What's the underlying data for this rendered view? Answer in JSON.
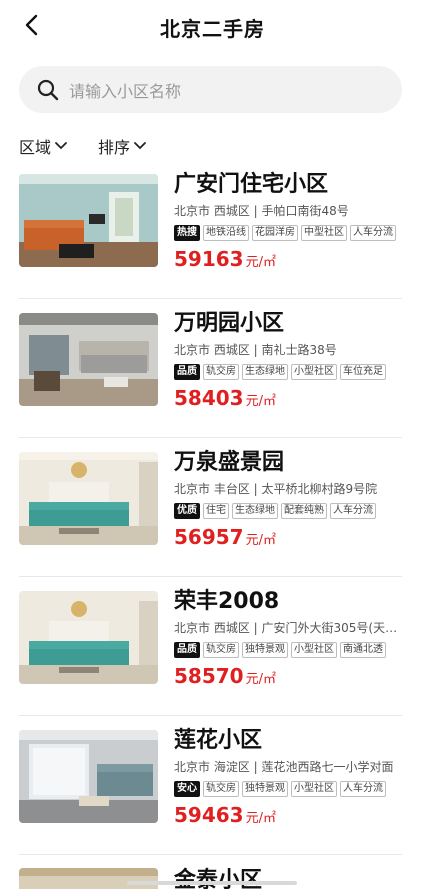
{
  "header": {
    "title": "北京二手房"
  },
  "search": {
    "placeholder": "请输入小区名称"
  },
  "filters": [
    {
      "label": "区域"
    },
    {
      "label": "排序"
    }
  ],
  "listings": [
    {
      "name": "广安门住宅小区",
      "address": "北京市 西城区 | 手帕口南街48号",
      "tags": [
        "热搜",
        "地铁沿线",
        "花园洋房",
        "中型社区",
        "人车分流"
      ],
      "price": "59163",
      "unit": "元/㎡"
    },
    {
      "name": "万明园小区",
      "address": "北京市 西城区 | 南礼士路38号",
      "tags": [
        "品质",
        "轨交房",
        "生态绿地",
        "小型社区",
        "车位充足"
      ],
      "price": "58403",
      "unit": "元/㎡"
    },
    {
      "name": "万泉盛景园",
      "address": "北京市 丰台区 | 太平桥北柳村路9号院",
      "tags": [
        "优质",
        "住宅",
        "生态绿地",
        "配套纯熟",
        "人车分流"
      ],
      "price": "56957",
      "unit": "元/㎡"
    },
    {
      "name": "荣丰2008",
      "address": "北京市 西城区 | 广安门外大街305号(天…",
      "tags": [
        "品质",
        "轨交房",
        "独特景观",
        "小型社区",
        "南通北透"
      ],
      "price": "58570",
      "unit": "元/㎡"
    },
    {
      "name": "莲花小区",
      "address": "北京市 海淀区 | 莲花池西路七一小学对面",
      "tags": [
        "安心",
        "轨交房",
        "独特景观",
        "小型社区",
        "人车分流"
      ],
      "price": "59463",
      "unit": "元/㎡"
    }
  ],
  "partial_listing": {
    "name": "金泰小区"
  },
  "colors": {
    "price": "#e02020",
    "tag_dark_bg": "#111111",
    "search_bg": "#f2f2f2"
  }
}
